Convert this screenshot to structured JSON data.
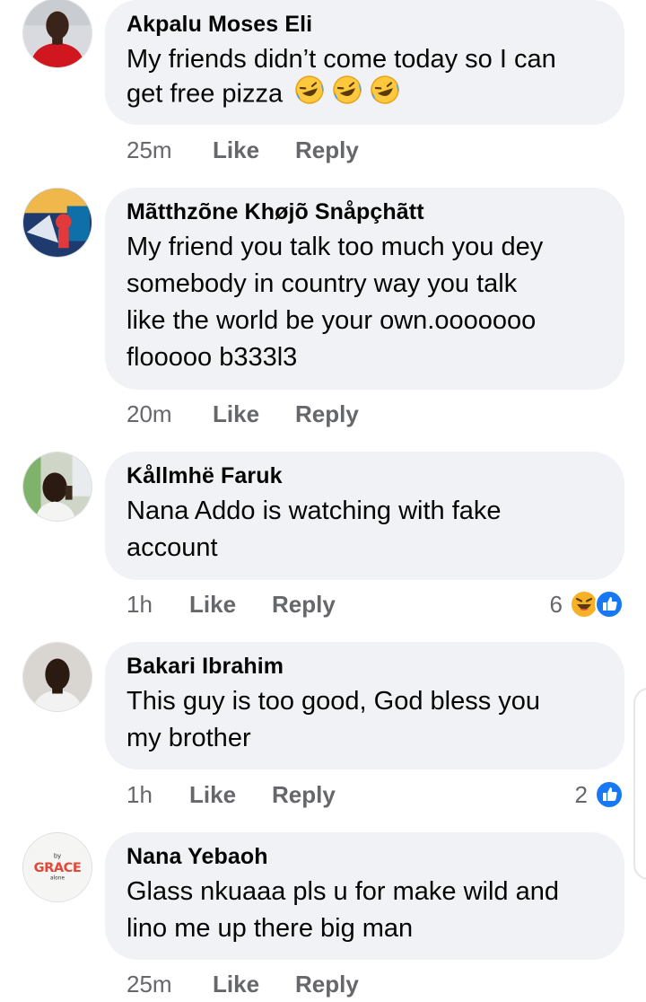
{
  "comments": [
    {
      "author": "Akpalu Moses Eli",
      "lines": [
        "My friends didn’t come today so I can",
        "get free pizza"
      ],
      "emoji": [
        "laughing-tears-emoji",
        "laughing-tears-emoji",
        "laughing-tears-emoji"
      ],
      "time": "25m",
      "like": "Like",
      "reply": "Reply"
    },
    {
      "author": "Mãtthzõne Khøjõ Snåpçhãtt",
      "lines": [
        "My friend you talk too much you dey",
        "somebody in country way you talk",
        "like the world be your own.ooooooo",
        "flooooo b333l3"
      ],
      "time": "20m",
      "like": "Like",
      "reply": "Reply"
    },
    {
      "author": "Kållmhë Faruk",
      "lines": [
        "Nana Addo is watching with fake",
        "account"
      ],
      "time": "1h",
      "like": "Like",
      "reply": "Reply",
      "reactions": {
        "count": "6",
        "icons": [
          "haha-reaction-icon",
          "like-reaction-icon"
        ]
      }
    },
    {
      "author": "Bakari Ibrahim",
      "lines": [
        "This guy is too good, God bless you",
        "my brother"
      ],
      "time": "1h",
      "like": "Like",
      "reply": "Reply",
      "reactions": {
        "count": "2",
        "icons": [
          "like-reaction-icon"
        ]
      }
    },
    {
      "author": "Nana Yebaoh",
      "avatar_text": {
        "top": "by",
        "main": "GRACE",
        "bottom": "alone"
      },
      "lines": [
        "Glass nkuaaa pls u for make wild and",
        "lino me up there big man"
      ],
      "time": "25m",
      "like": "Like",
      "reply": "Reply"
    }
  ],
  "colors": {
    "bubble": "#f0f2f5",
    "meta": "#65676b",
    "like_blue": "#1877f2",
    "haha_yellow": "#f7b125"
  }
}
